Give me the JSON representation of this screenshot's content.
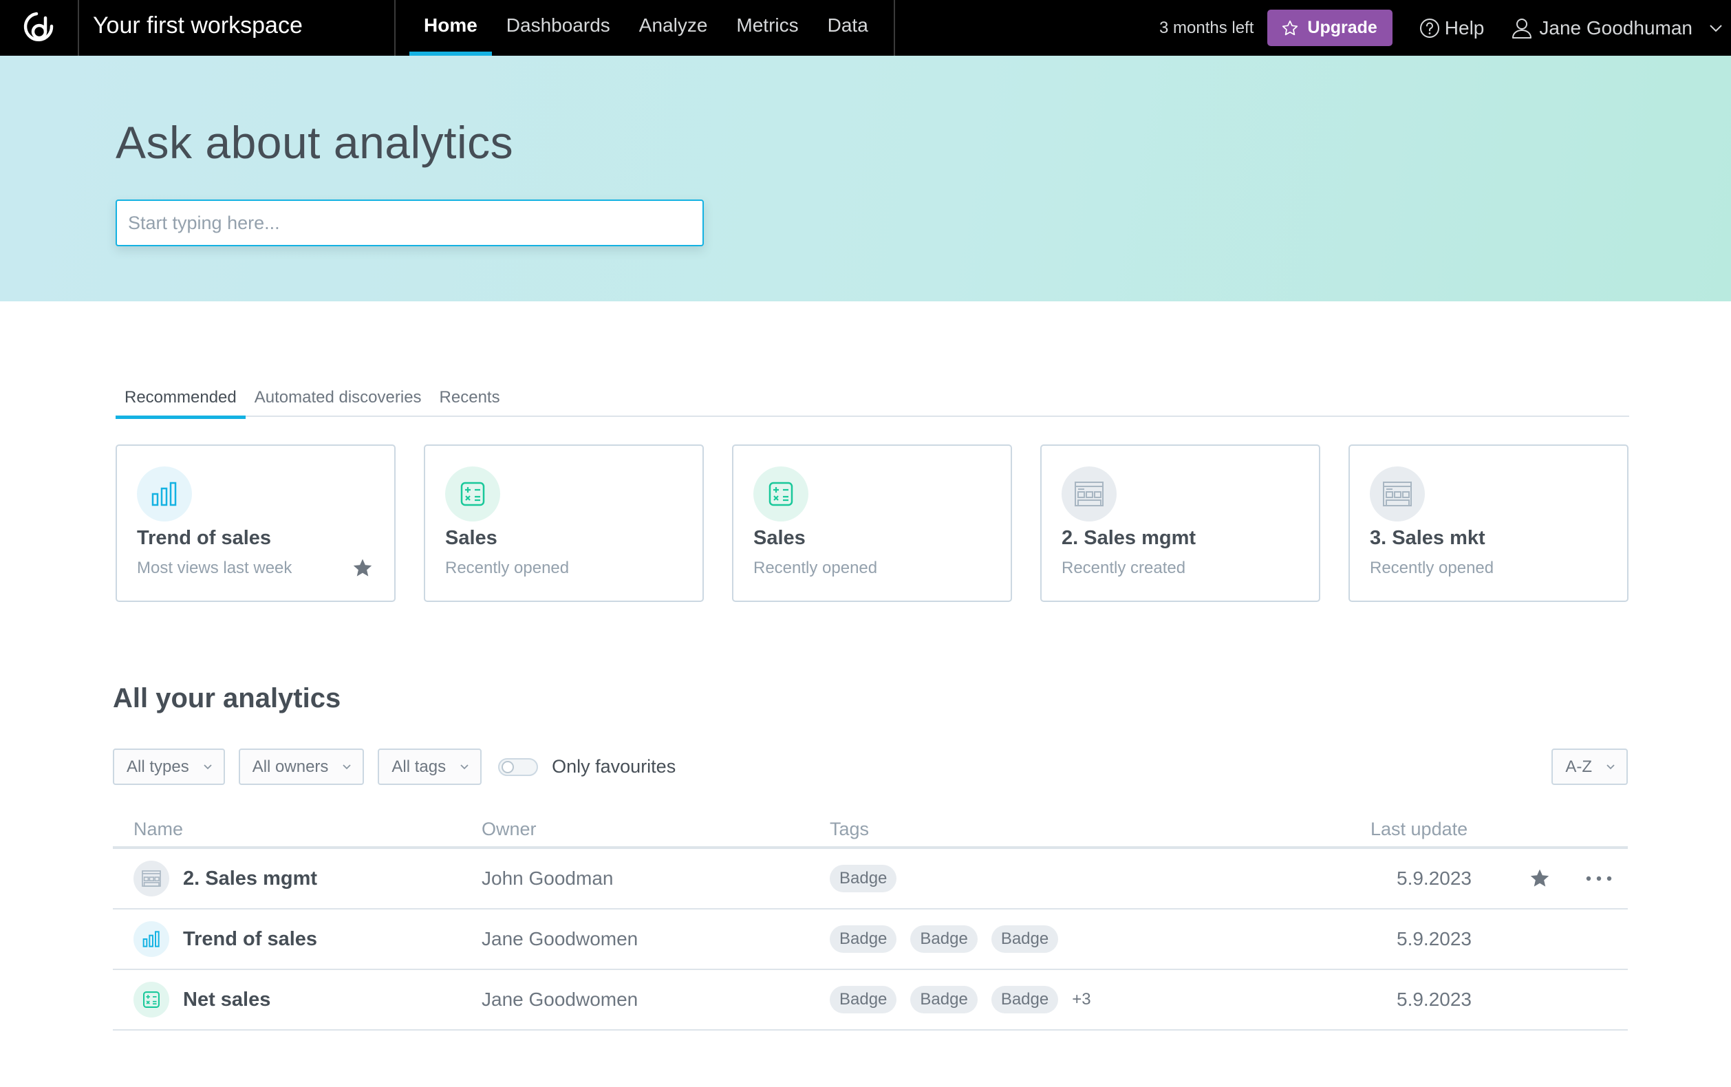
{
  "topbar": {
    "logo_icon": "gooddata-logo-icon",
    "workspace_title": "Your first workspace",
    "nav": [
      {
        "label": "Home",
        "active": true
      },
      {
        "label": "Dashboards",
        "active": false
      },
      {
        "label": "Analyze",
        "active": false
      },
      {
        "label": "Metrics",
        "active": false
      },
      {
        "label": "Data",
        "active": false
      }
    ],
    "trial_text": "3 months left",
    "upgrade_label": "Upgrade",
    "upgrade_icon": "star-outline-icon",
    "help_label": "Help",
    "help_icon": "question-circle-icon",
    "user_name": "Jane Goodhuman",
    "user_icon": "user-icon",
    "user_menu_icon": "chevron-down-icon"
  },
  "hero": {
    "title": "Ask about analytics",
    "search_placeholder": "Start typing here...",
    "search_value": ""
  },
  "tabs": [
    {
      "label": "Recommended",
      "active": true
    },
    {
      "label": "Automated discoveries",
      "active": false
    },
    {
      "label": "Recents",
      "active": false
    }
  ],
  "cards": [
    {
      "title": "Trend of sales",
      "subtitle": "Most views last week",
      "icon": "bar-chart-icon",
      "favourite": true
    },
    {
      "title": "Sales",
      "subtitle": "Recently opened",
      "icon": "calculator-icon",
      "favourite": false
    },
    {
      "title": "Sales",
      "subtitle": "Recently opened",
      "icon": "calculator-icon",
      "favourite": false
    },
    {
      "title": "2. Sales mgmt",
      "subtitle": "Recently created",
      "icon": "dashboard-icon",
      "favourite": false
    },
    {
      "title": "3. Sales mkt",
      "subtitle": "Recently opened",
      "icon": "dashboard-icon",
      "favourite": false
    }
  ],
  "analytics": {
    "title": "All your analytics",
    "filters": {
      "types": "All types",
      "owners": "All owners",
      "tags": "All tags",
      "only_favourites_label": "Only favourites",
      "only_favourites_on": false
    },
    "sort": "A-Z",
    "columns": {
      "name": "Name",
      "owner": "Owner",
      "tags": "Tags",
      "last_update": "Last update"
    },
    "rows": [
      {
        "name": "2. Sales mgmt",
        "icon": "dashboard-icon",
        "owner": "John Goodman",
        "tags": [
          "Badge"
        ],
        "more_tags": "",
        "last_update": "5.9.2023",
        "favourite": true,
        "show_actions": true
      },
      {
        "name": "Trend of sales",
        "icon": "bar-chart-icon",
        "owner": "Jane Goodwomen",
        "tags": [
          "Badge",
          "Badge",
          "Badge"
        ],
        "more_tags": "",
        "last_update": "5.9.2023",
        "favourite": false,
        "show_actions": false
      },
      {
        "name": "Net sales",
        "icon": "calculator-icon",
        "owner": "Jane Goodwomen",
        "tags": [
          "Badge",
          "Badge",
          "Badge"
        ],
        "more_tags": "+3",
        "last_update": "5.9.2023",
        "favourite": false,
        "show_actions": false
      }
    ]
  },
  "colors": {
    "accent": "#14b2e2",
    "upgrade": "#8e52a8",
    "metric_green": "#19c89a",
    "text_dark": "#464e56",
    "text_muted": "#94a1ad"
  }
}
